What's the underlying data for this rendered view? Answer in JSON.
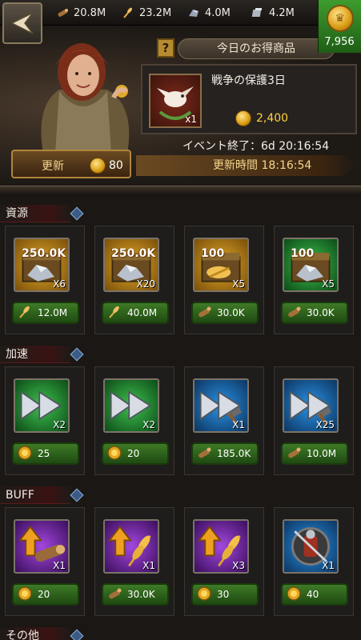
{
  "topbar": {
    "resources": [
      {
        "icon": "wood-icon",
        "value": "20.8M"
      },
      {
        "icon": "wheat-icon",
        "value": "23.2M"
      },
      {
        "icon": "iron-icon",
        "value": "4.0M"
      },
      {
        "icon": "stone-icon",
        "value": "4.2M"
      }
    ],
    "gold": "7,956"
  },
  "offer": {
    "help_label": "?",
    "title": "今日のお得商品",
    "item_name": "戦争の保護3日",
    "item_qty": "x1",
    "price": "2,400",
    "event_end": "イベント終了：6d 20:16:54"
  },
  "refresh": {
    "label": "更新",
    "cost": "80",
    "time": "更新時間 18:16:54"
  },
  "sections": [
    {
      "label": "資源",
      "cards": [
        {
          "badge": "250.0K",
          "qty": "X6",
          "bg": "bg-gold",
          "icon": "iron-chest-icon",
          "price_icon": "wheat-icon",
          "price": "12.0M"
        },
        {
          "badge": "250.0K",
          "qty": "X20",
          "bg": "bg-gold",
          "icon": "iron-chest-icon",
          "price_icon": "wheat-icon",
          "price": "40.0M"
        },
        {
          "badge": "100",
          "qty": "X5",
          "bg": "bg-gold",
          "icon": "wheat-chest-icon",
          "price_icon": "wood-icon",
          "price": "30.0K"
        },
        {
          "badge": "100",
          "qty": "X5",
          "bg": "bg-green",
          "icon": "iron-chest-icon",
          "price_icon": "wood-icon",
          "price": "30.0K"
        }
      ]
    },
    {
      "label": "加速",
      "cards": [
        {
          "badge": "",
          "qty": "X2",
          "bg": "bg-green",
          "icon": "speedup-icon",
          "price_icon": "gold-coin-icon",
          "price": "25"
        },
        {
          "badge": "",
          "qty": "X2",
          "bg": "bg-green",
          "icon": "speedup-icon",
          "price_icon": "gold-coin-icon",
          "price": "20"
        },
        {
          "badge": "",
          "qty": "X1",
          "bg": "bg-blue",
          "icon": "build-speedup-icon",
          "price_icon": "wood-icon",
          "price": "185.0K"
        },
        {
          "badge": "",
          "qty": "X25",
          "bg": "bg-blue",
          "icon": "build-speedup-icon",
          "price_icon": "wood-icon",
          "price": "10.0M"
        }
      ]
    },
    {
      "label": "BUFF",
      "cards": [
        {
          "badge": "",
          "qty": "X1",
          "bg": "bg-purple",
          "icon": "wood-boost-icon",
          "price_icon": "gold-coin-icon",
          "price": "20"
        },
        {
          "badge": "",
          "qty": "X1",
          "bg": "bg-purple",
          "icon": "wheat-boost-icon",
          "price_icon": "wood-icon",
          "price": "30.0K"
        },
        {
          "badge": "",
          "qty": "X3",
          "bg": "bg-purple",
          "icon": "wheat-boost-icon",
          "price_icon": "gold-coin-icon",
          "price": "30"
        },
        {
          "badge": "",
          "qty": "X1",
          "bg": "bg-blue",
          "icon": "army-boost-icon",
          "price_icon": "gold-coin-icon",
          "price": "40"
        }
      ]
    },
    {
      "label": "その他",
      "cards": []
    }
  ]
}
